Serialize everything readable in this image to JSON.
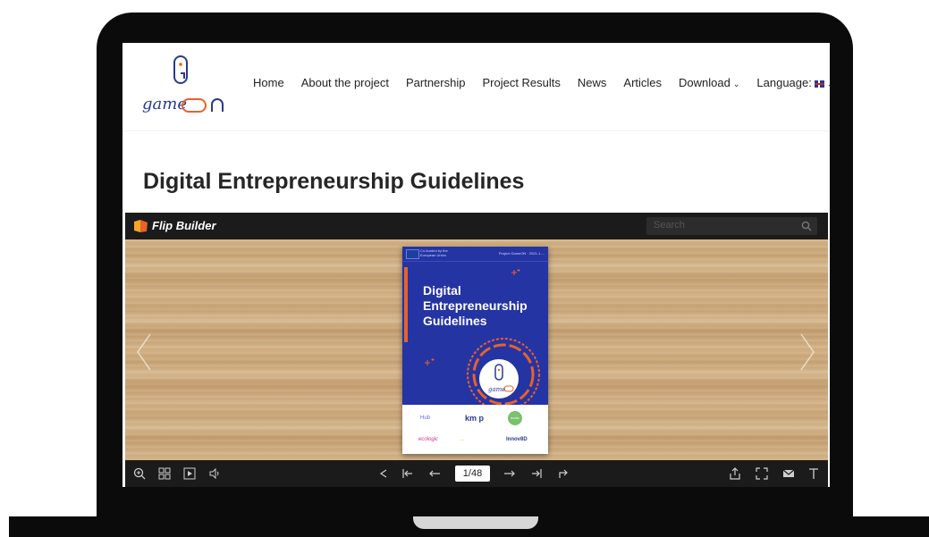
{
  "nav": {
    "items": [
      "Home",
      "About the project",
      "Partnership",
      "Project Results",
      "News",
      "Articles",
      "Download",
      "Language:"
    ],
    "dropdown_items": [
      "Download",
      "Language:"
    ]
  },
  "logo": {
    "text": "game"
  },
  "page": {
    "title": "Digital Entrepreneurship Guidelines"
  },
  "viewer": {
    "brand": "Flip Builder",
    "search_placeholder": "Search",
    "page_indicator": "1/48"
  },
  "book": {
    "funded_by": "Co-funded by the European Union",
    "project_line": "Project GameON · 2021-1-...",
    "title": "Digital Entrepreneurship Guidelines",
    "partners": [
      "Hub",
      "km p",
      "ecolo",
      "ecologic",
      "...",
      "Innov8D"
    ]
  },
  "colors": {
    "brand_blue": "#2434a3",
    "brand_orange": "#e8622a",
    "toolbar": "#1b1b1b"
  }
}
